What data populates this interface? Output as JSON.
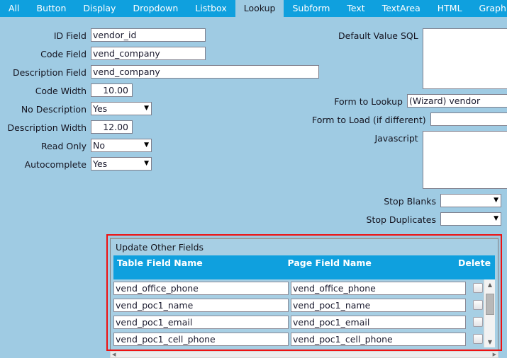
{
  "tabs": [
    {
      "label": "All",
      "active": false
    },
    {
      "label": "Button",
      "active": false
    },
    {
      "label": "Display",
      "active": false
    },
    {
      "label": "Dropdown",
      "active": false
    },
    {
      "label": "Listbox",
      "active": false
    },
    {
      "label": "Lookup",
      "active": true
    },
    {
      "label": "Subform",
      "active": false
    },
    {
      "label": "Text",
      "active": false
    },
    {
      "label": "TextArea",
      "active": false
    },
    {
      "label": "HTML",
      "active": false
    },
    {
      "label": "Graph",
      "active": false
    }
  ],
  "colors": {
    "page_background": "#9fcbe3",
    "tab_blue": "#0fa0de",
    "highlight_red": "#ee1111",
    "panel_background": "#a7cfe4"
  },
  "left_form": {
    "id_field": {
      "label": "ID Field",
      "value": "vendor_id"
    },
    "code_field": {
      "label": "Code Field",
      "value": "vend_company"
    },
    "description_field": {
      "label": "Description Field",
      "value": "vend_company"
    },
    "code_width": {
      "label": "Code Width",
      "value": "10.00"
    },
    "no_description": {
      "label": "No Description",
      "value": "Yes"
    },
    "description_width": {
      "label": "Description Width",
      "value": "12.00"
    },
    "read_only": {
      "label": "Read Only",
      "value": "No"
    },
    "autocomplete": {
      "label": "Autocomplete",
      "value": "Yes"
    }
  },
  "right_form": {
    "default_value_sql": {
      "label": "Default Value SQL",
      "value": ""
    },
    "form_to_lookup": {
      "label": "Form to Lookup",
      "value": "(Wizard) vendor"
    },
    "form_to_load": {
      "label": "Form to Load (if different)",
      "value": ""
    },
    "javascript": {
      "label": "Javascript",
      "value": ""
    },
    "stop_blanks": {
      "label": "Stop Blanks",
      "value": ""
    },
    "stop_duplicates": {
      "label": "Stop Duplicates",
      "value": ""
    }
  },
  "update_other_fields": {
    "title": "Update Other Fields",
    "columns": {
      "table_field_name": "Table Field Name",
      "page_field_name": "Page Field Name",
      "delete": "Delete"
    },
    "rows": [
      {
        "table_field_name": "vend_office_phone",
        "page_field_name": "vend_office_phone",
        "delete_checked": false
      },
      {
        "table_field_name": "vend_poc1_name",
        "page_field_name": "vend_poc1_name",
        "delete_checked": false
      },
      {
        "table_field_name": "vend_poc1_email",
        "page_field_name": "vend_poc1_email",
        "delete_checked": false
      },
      {
        "table_field_name": "vend_poc1_cell_phone",
        "page_field_name": "vend_poc1_cell_phone",
        "delete_checked": false
      }
    ]
  },
  "icons": {
    "dropdown_arrow": "▼",
    "scroll_up": "▲",
    "scroll_down": "▼",
    "scroll_left": "◀",
    "scroll_right": "▶"
  }
}
